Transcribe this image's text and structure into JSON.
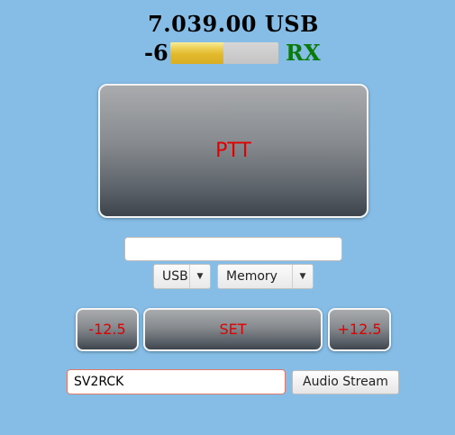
{
  "header": {
    "frequency_text": "7.039.00 USB",
    "signal_value": "-6",
    "signal_meter_level": 0.49,
    "status": "RX",
    "status_color": "#0a7a0a"
  },
  "controls": {
    "ptt_label": "PTT",
    "message_value": "",
    "mode_select_value": "USB",
    "memory_select_value": "Memory",
    "step_down_label": "-12.5",
    "set_label": "SET",
    "step_up_label": "+12.5",
    "callsign_value": "SV2RCK",
    "audio_stream_label": "Audio Stream"
  },
  "colors": {
    "background": "#85bde6",
    "button_text": "#e00000",
    "meter_fill": "#e2b92c"
  }
}
